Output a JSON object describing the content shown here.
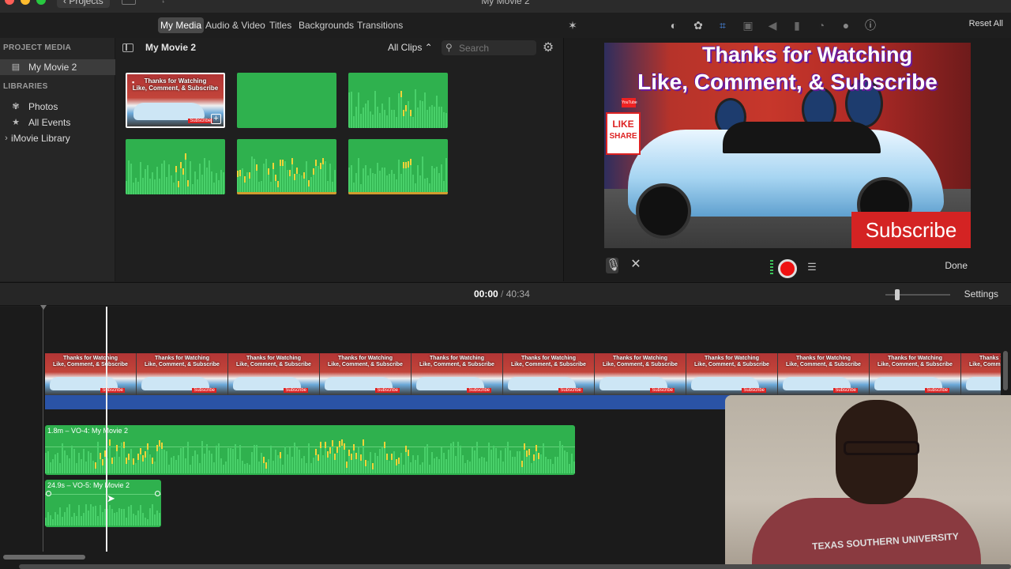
{
  "window": {
    "title": "My Movie 2",
    "projects_label": "Projects"
  },
  "browser_tabs": [
    {
      "label": "My Media",
      "active": true
    },
    {
      "label": "Audio & Video",
      "active": false
    },
    {
      "label": "Titles",
      "active": false
    },
    {
      "label": "Backgrounds",
      "active": false
    },
    {
      "label": "Transitions",
      "active": false
    }
  ],
  "viewer_toolbar": {
    "reset_all": "Reset All"
  },
  "sidebar": {
    "project_media_header": "PROJECT MEDIA",
    "project_item": "My Movie 2",
    "libraries_header": "LIBRARIES",
    "items": [
      {
        "label": "Photos",
        "icon": "photos-icon"
      },
      {
        "label": "All Events",
        "icon": "star-icon"
      },
      {
        "label": "iMovie Library",
        "icon": "disclosure-icon"
      }
    ]
  },
  "browser": {
    "title": "My Movie 2",
    "clips_filter": "All Clips",
    "search_placeholder": "Search",
    "thumb_line1": "Thanks for Watching",
    "thumb_line2": "Like, Comment, & Subscribe",
    "thumb_sub": "Subscribe"
  },
  "viewer": {
    "line1": "Thanks for Watching",
    "line2": "Like, Comment, & Subscribe",
    "like": "LIKE",
    "share": "SHARE",
    "youtube": "YouTube",
    "subscribe": "Subscribe",
    "done": "Done"
  },
  "timeline": {
    "current_time": "00:00",
    "separator": "/",
    "total_time": "40:34",
    "settings": "Settings",
    "frame_line1": "Thanks for Watching",
    "frame_line2": "Like, Comment, & Subscribe",
    "frame_sub": "Subscribe",
    "audio_clip_1": "1.8m – VO-4: My Movie 2",
    "audio_clip_2": "24.9s – VO-5: My Movie 2"
  },
  "webcam": {
    "shirt_text": "TEXAS SOUTHERN UNIVERSITY"
  },
  "colors": {
    "audio_green": "#2fb14e",
    "blue_bar": "#2a53a6",
    "record_red": "#e11111"
  }
}
